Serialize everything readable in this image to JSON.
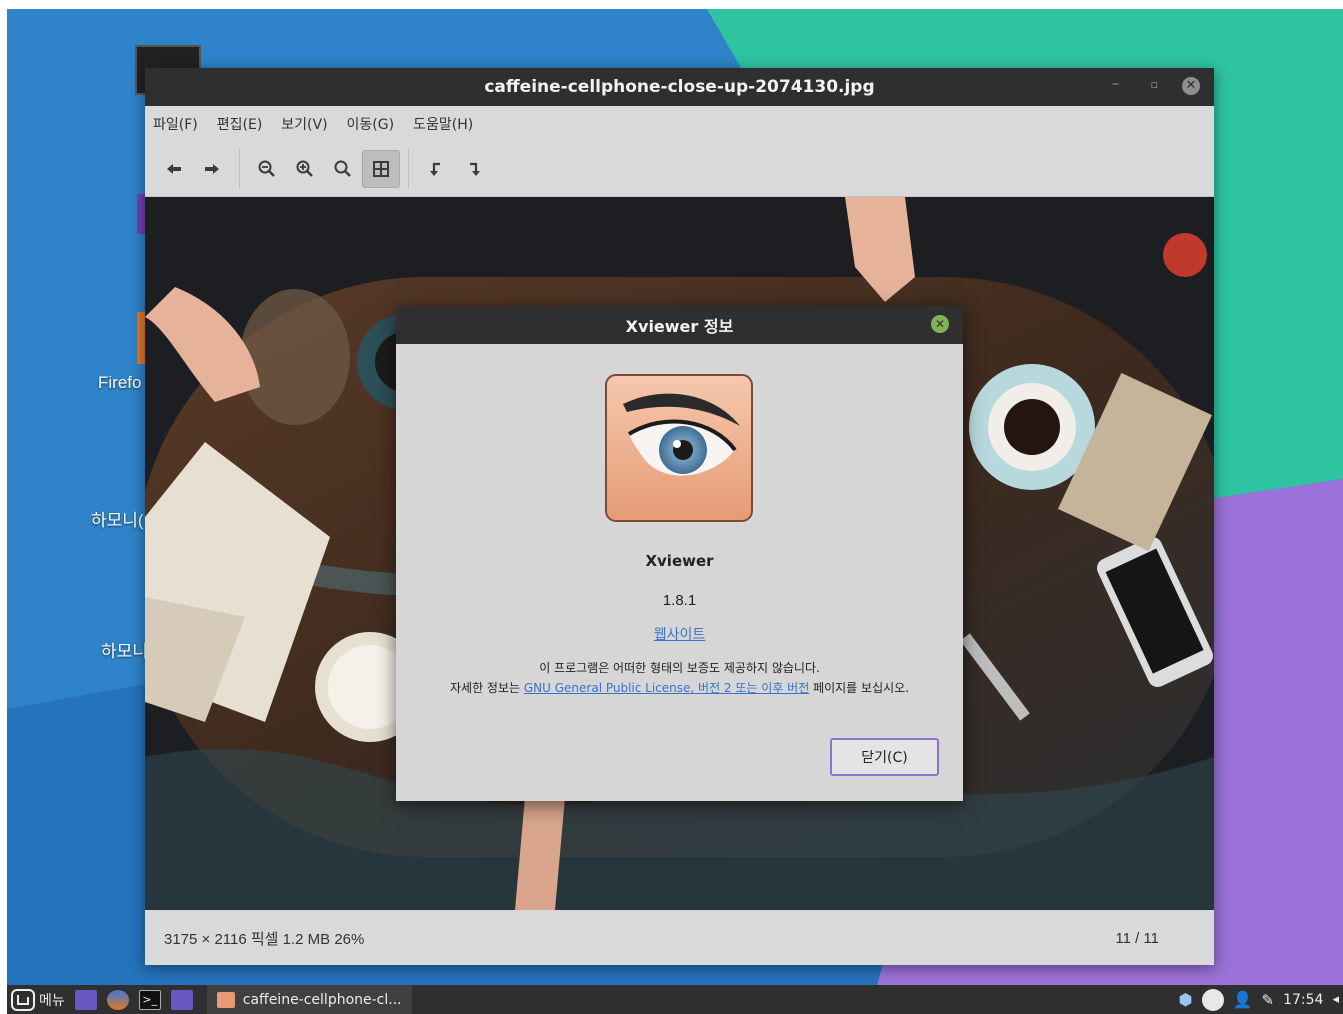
{
  "window": {
    "title": "caffeine-cellphone-close-up-2074130.jpg"
  },
  "menu": [
    {
      "label": "파일(F)"
    },
    {
      "label": "편집(E)"
    },
    {
      "label": "보기(V)"
    },
    {
      "label": "이동(G)"
    },
    {
      "label": "도움말(H)"
    }
  ],
  "toolbar": {
    "back_icon": "arrow-left-icon",
    "forward_icon": "arrow-right-icon",
    "zoom_out_icon": "zoom-out-icon",
    "zoom_in_icon": "zoom-in-icon",
    "zoom_fit_icon": "zoom-normal-icon",
    "best_fit_icon": "best-fit-icon",
    "rotate_left_icon": "rotate-left-icon",
    "rotate_right_icon": "rotate-right-icon"
  },
  "status": {
    "info": "3175 × 2116 픽셀  1.2 MB   26%",
    "page": "11 / 11"
  },
  "desktop": {
    "labels": [
      "Firefo",
      "하모니(",
      "하모니"
    ]
  },
  "dialog": {
    "title": "Xviewer 정보",
    "app_name": "Xviewer",
    "version": "1.8.1",
    "website": "웹사이트",
    "license_line1": "이 프로그램은 어떠한 형태의 보증도 제공하지 않습니다.",
    "license_prefix": "자세한 정보는 ",
    "license_link": "GNU General Public License, 버전 2 또는 이후 버전",
    "license_suffix": " 페이지를 보십시오.",
    "close_label": "닫기(C)"
  },
  "taskbar": {
    "menu_label": "메뉴",
    "task_label": "caffeine-cellphone-cl...",
    "clock": "17:54"
  },
  "colors": {
    "accent": "#8f72c9",
    "link": "#3b73c8",
    "titlebar": "#2f2f2f"
  }
}
